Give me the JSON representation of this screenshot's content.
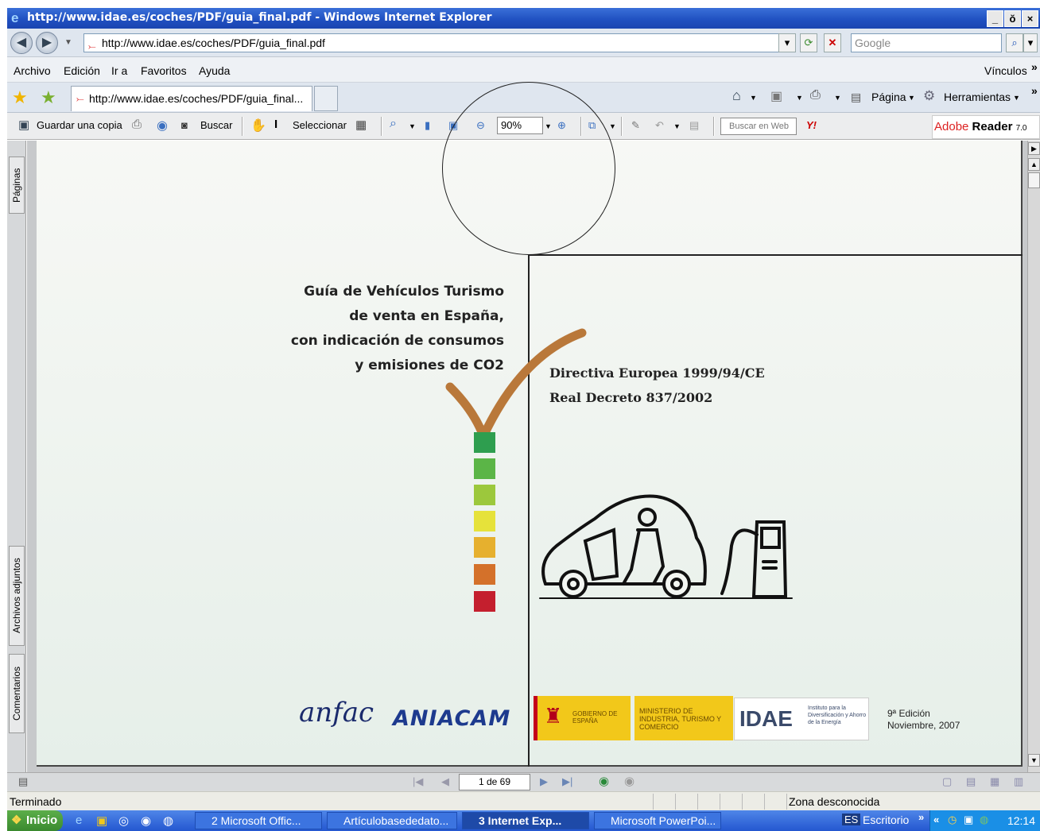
{
  "window": {
    "title": "http://www.idae.es/coches/PDF/guia_final.pdf - Windows Internet Explorer",
    "minimize": "_",
    "restore": "ŏ",
    "close": "×"
  },
  "address": {
    "url": "http://www.idae.es/coches/PDF/guia_final.pdf",
    "search_placeholder": "Google"
  },
  "menu": {
    "items": [
      "Archivo",
      "Edición",
      "Ir a",
      "Favoritos",
      "Ayuda"
    ],
    "links": "Vínculos"
  },
  "tabbar": {
    "tab_label": "http://www.idae.es/coches/PDF/guia_final...",
    "page_label": "Página",
    "tools_label": "Herramientas"
  },
  "reader": {
    "save_copy": "Guardar una copia",
    "search": "Buscar",
    "select": "Seleccionar",
    "zoom": "90%",
    "web_search": "Buscar en Web",
    "logo_brand": "Adobe",
    "logo_product": "Reader",
    "logo_version": "7.0"
  },
  "sidepanel": {
    "pages": "Páginas",
    "attachments": "Archivos adjuntos",
    "comments": "Comentarios"
  },
  "document": {
    "guide_lines": [
      "Guía de Vehículos Turismo",
      "de venta en España,",
      "con indicación de consumos",
      "y emisiones de CO2"
    ],
    "directive_1": "Directiva Europea 1999/94/CE",
    "directive_2": "Real Decreto 837/2002",
    "edition": "9ª Edición",
    "edition_date": "Noviembre, 2007",
    "anfac": "anfac",
    "aniacam": "ANIACAM",
    "gob_text": "GOBIERNO DE ESPAÑA",
    "ministry_text": "MINISTERIO DE INDUSTRIA, TURISMO Y COMERCIO",
    "idae_text": "IDAE",
    "idae_subtext": "Instituto para la Diversificación y Ahorro de la Energía",
    "scale_colors": [
      "#2e9e4f",
      "#5bb547",
      "#9cc83c",
      "#e6e23a",
      "#e6b02e",
      "#d4712a",
      "#c41f2e"
    ]
  },
  "navigation": {
    "page_indicator": "1 de 69"
  },
  "status": {
    "text": "Terminado",
    "zone": "Zona desconocida"
  },
  "taskbar": {
    "start": "Inicio",
    "tasks": [
      "2 Microsoft Offic...",
      "Artículobasededato...",
      "3 Internet Exp...",
      "Microsoft PowerPoi..."
    ],
    "lang": "ES",
    "desktop": "Escritorio",
    "clock": "12:14"
  }
}
